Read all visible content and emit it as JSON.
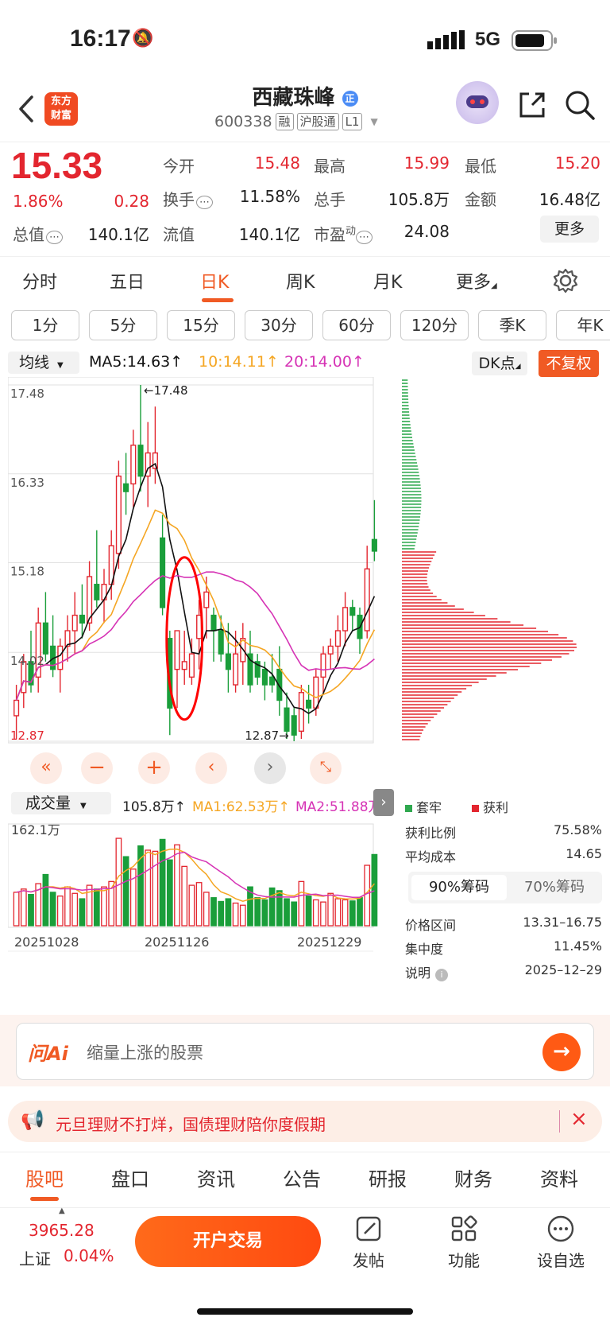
{
  "status": {
    "time": "16:17",
    "network": "5G"
  },
  "nav": {
    "logo_line1": "东方",
    "logo_line2": "财富",
    "stock_name": "西藏珠峰",
    "stock_code": "600338",
    "tags": [
      "融",
      "沪股通",
      "L1"
    ]
  },
  "quote": {
    "price": "15.33",
    "change_pct": "1.86%",
    "change": "0.28",
    "open_label": "今开",
    "open": "15.48",
    "high_label": "最高",
    "high": "15.99",
    "low_label": "最低",
    "low": "15.20",
    "turnover_label": "换手",
    "turnover": "11.58%",
    "volume_label": "总手",
    "volume": "105.8万",
    "amount_label": "金额",
    "amount": "16.48亿",
    "mktcap_label": "总值",
    "mktcap": "140.1亿",
    "float_label": "流值",
    "float": "140.1亿",
    "pe_label": "市盈",
    "pe_sup": "动",
    "pe": "24.08",
    "more_label": "更多"
  },
  "tabs": [
    "分时",
    "五日",
    "日K",
    "周K",
    "月K",
    "更多"
  ],
  "active_tab": "日K",
  "periods": [
    "1分",
    "5分",
    "15分",
    "30分",
    "60分",
    "120分",
    "季K",
    "年K"
  ],
  "ma_row": {
    "selector": "均线",
    "ma5": "MA5:14.63",
    "ma10": "10:14.11",
    "ma20": "20:14.00",
    "dk": "DK点",
    "fq": "不复权",
    "color_ma5": "#111111",
    "color_ma10": "#f5a623",
    "color_ma20": "#d633b5"
  },
  "chart_data": {
    "type": "candlestick",
    "y_ticks": [
      "17.48",
      "16.33",
      "15.18",
      "14.02",
      "12.87"
    ],
    "ylim": [
      12.87,
      17.48
    ],
    "high_marker": "17.48",
    "low_marker": "12.87",
    "x_ticks": [
      "20251028",
      "20251126",
      "20251229"
    ],
    "candles": [
      {
        "o": 13.2,
        "h": 13.6,
        "l": 12.9,
        "c": 13.4
      },
      {
        "o": 13.5,
        "h": 14.0,
        "l": 13.3,
        "c": 13.9
      },
      {
        "o": 13.9,
        "h": 14.3,
        "l": 13.5,
        "c": 13.6
      },
      {
        "o": 13.7,
        "h": 14.6,
        "l": 13.5,
        "c": 14.4
      },
      {
        "o": 14.4,
        "h": 14.8,
        "l": 13.9,
        "c": 14.0
      },
      {
        "o": 14.1,
        "h": 14.5,
        "l": 13.7,
        "c": 13.8
      },
      {
        "o": 13.8,
        "h": 14.2,
        "l": 13.5,
        "c": 14.1
      },
      {
        "o": 14.1,
        "h": 14.5,
        "l": 13.9,
        "c": 14.3
      },
      {
        "o": 14.3,
        "h": 14.8,
        "l": 14.0,
        "c": 14.5
      },
      {
        "o": 14.5,
        "h": 14.9,
        "l": 14.2,
        "c": 14.4
      },
      {
        "o": 14.4,
        "h": 15.2,
        "l": 14.3,
        "c": 15.0
      },
      {
        "o": 14.9,
        "h": 15.6,
        "l": 14.6,
        "c": 14.7
      },
      {
        "o": 14.7,
        "h": 15.1,
        "l": 14.4,
        "c": 14.9
      },
      {
        "o": 14.9,
        "h": 15.6,
        "l": 14.7,
        "c": 15.4
      },
      {
        "o": 15.3,
        "h": 16.5,
        "l": 15.1,
        "c": 16.3
      },
      {
        "o": 16.2,
        "h": 16.6,
        "l": 15.8,
        "c": 16.1
      },
      {
        "o": 16.2,
        "h": 16.9,
        "l": 15.9,
        "c": 16.7
      },
      {
        "o": 16.7,
        "h": 17.48,
        "l": 16.1,
        "c": 16.3
      },
      {
        "o": 16.3,
        "h": 17.0,
        "l": 15.9,
        "c": 16.6
      },
      {
        "o": 16.4,
        "h": 17.2,
        "l": 16.2,
        "c": 16.6
      },
      {
        "o": 15.5,
        "h": 15.8,
        "l": 14.5,
        "c": 14.6
      },
      {
        "o": 14.2,
        "h": 14.3,
        "l": 12.95,
        "c": 13.3
      },
      {
        "o": 13.8,
        "h": 14.3,
        "l": 13.3,
        "c": 14.3
      },
      {
        "o": 13.8,
        "h": 14.3,
        "l": 13.6,
        "c": 13.9
      },
      {
        "o": 13.7,
        "h": 14.2,
        "l": 13.6,
        "c": 14.0
      },
      {
        "o": 14.2,
        "h": 14.7,
        "l": 13.8,
        "c": 14.5
      },
      {
        "o": 14.6,
        "h": 15.0,
        "l": 14.2,
        "c": 14.8
      },
      {
        "o": 14.5,
        "h": 14.6,
        "l": 13.9,
        "c": 14.3
      },
      {
        "o": 14.3,
        "h": 14.5,
        "l": 13.9,
        "c": 14.0
      },
      {
        "o": 14.0,
        "h": 14.4,
        "l": 13.5,
        "c": 13.8
      },
      {
        "o": 13.6,
        "h": 14.3,
        "l": 13.5,
        "c": 14.0
      },
      {
        "o": 13.9,
        "h": 14.4,
        "l": 13.6,
        "c": 14.2
      },
      {
        "o": 14.0,
        "h": 14.3,
        "l": 13.5,
        "c": 13.6
      },
      {
        "o": 13.9,
        "h": 14.0,
        "l": 13.6,
        "c": 13.7
      },
      {
        "o": 13.8,
        "h": 13.9,
        "l": 13.4,
        "c": 13.6
      },
      {
        "o": 13.7,
        "h": 14.0,
        "l": 13.5,
        "c": 13.6
      },
      {
        "o": 13.8,
        "h": 14.1,
        "l": 13.2,
        "c": 13.4
      },
      {
        "o": 13.3,
        "h": 13.5,
        "l": 12.9,
        "c": 13.0
      },
      {
        "o": 13.2,
        "h": 13.3,
        "l": 12.87,
        "c": 12.95
      },
      {
        "o": 13.0,
        "h": 13.6,
        "l": 12.9,
        "c": 13.5
      },
      {
        "o": 13.4,
        "h": 13.6,
        "l": 13.1,
        "c": 13.3
      },
      {
        "o": 13.3,
        "h": 13.8,
        "l": 13.2,
        "c": 13.7
      },
      {
        "o": 13.7,
        "h": 14.1,
        "l": 13.5,
        "c": 14.0
      },
      {
        "o": 14.0,
        "h": 14.2,
        "l": 13.8,
        "c": 14.1
      },
      {
        "o": 14.1,
        "h": 14.5,
        "l": 13.9,
        "c": 14.3
      },
      {
        "o": 14.3,
        "h": 14.8,
        "l": 14.1,
        "c": 14.6
      },
      {
        "o": 14.6,
        "h": 14.7,
        "l": 14.3,
        "c": 14.5
      },
      {
        "o": 14.5,
        "h": 14.6,
        "l": 14.0,
        "c": 14.2
      },
      {
        "o": 14.3,
        "h": 15.4,
        "l": 14.2,
        "c": 15.1
      },
      {
        "o": 15.48,
        "h": 15.99,
        "l": 15.2,
        "c": 15.33
      }
    ],
    "volume": {
      "label": "成交量",
      "value": "105.8万",
      "ma1": "MA1:62.53万",
      "ma2": "MA2:51.88万",
      "max_label": "162.1万",
      "max": 162.1,
      "bars": [
        62,
        68,
        58,
        78,
        95,
        62,
        55,
        72,
        60,
        50,
        75,
        68,
        72,
        82,
        162,
        128,
        105,
        148,
        140,
        138,
        160,
        122,
        150,
        110,
        75,
        80,
        62,
        52,
        45,
        50,
        42,
        38,
        72,
        52,
        48,
        70,
        65,
        50,
        44,
        82,
        55,
        48,
        44,
        60,
        50,
        48,
        46,
        52,
        112,
        132
      ]
    }
  },
  "chips": {
    "legend_tao": "套牢",
    "legend_huoli": "获利",
    "profit_label": "获利比例",
    "profit": "75.58%",
    "avgcost_label": "平均成本",
    "avgcost": "14.65",
    "chip90": "90%筹码",
    "chip70": "70%筹码",
    "range_label": "价格区间",
    "range": "13.31–16.75",
    "conc_label": "集中度",
    "conc": "11.45%",
    "note_label": "说明",
    "date": "2025–12–29"
  },
  "ai": {
    "logo": "问Ai",
    "placeholder": "缩量上涨的股票"
  },
  "banner": {
    "text": "元旦理财不打烊，国债理财陪你度假期"
  },
  "bottom_tabs": [
    "股吧",
    "盘口",
    "资讯",
    "公告",
    "研报",
    "财务",
    "资料"
  ],
  "bottom_bar": {
    "index_value": "3965.28",
    "index_name": "上证",
    "index_pct": "0.04%",
    "open_account": "开户交易",
    "post": "发帖",
    "func": "功能",
    "watch": "设自选"
  }
}
